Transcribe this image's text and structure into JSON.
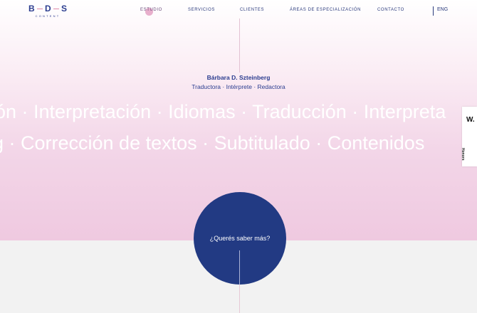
{
  "brand": {
    "logo_letters": [
      "B",
      "D",
      "S"
    ],
    "logo_subtitle": "CONTENT",
    "colors": {
      "navy": "#223a83",
      "pink": "#efc9e0",
      "accent_dot": "#e6a6c7"
    }
  },
  "nav": {
    "items": [
      {
        "label": "ESTUDIO",
        "active": true
      },
      {
        "label": "SERVICIOS",
        "active": false
      },
      {
        "label": "CLIENTES",
        "active": false
      },
      {
        "label": "ÁREAS DE ESPECIALIZACIÓN",
        "active": false
      },
      {
        "label": "CONTACTO",
        "active": false
      }
    ],
    "language": "ENG"
  },
  "hero": {
    "name": "Bárbara D. Szteinberg",
    "roles": "Traductora · Intérprete · Redactora",
    "marquee_row1": "ón · Interpretación · Idiomas · Traducción · Interpreta",
    "marquee_row2": "g · Corrección de textos · Subtitulado · Contenidos"
  },
  "cta": {
    "label": "¿Querés saber más?"
  },
  "awards_tab": {
    "icon_text": "W.",
    "label": "Honors"
  }
}
